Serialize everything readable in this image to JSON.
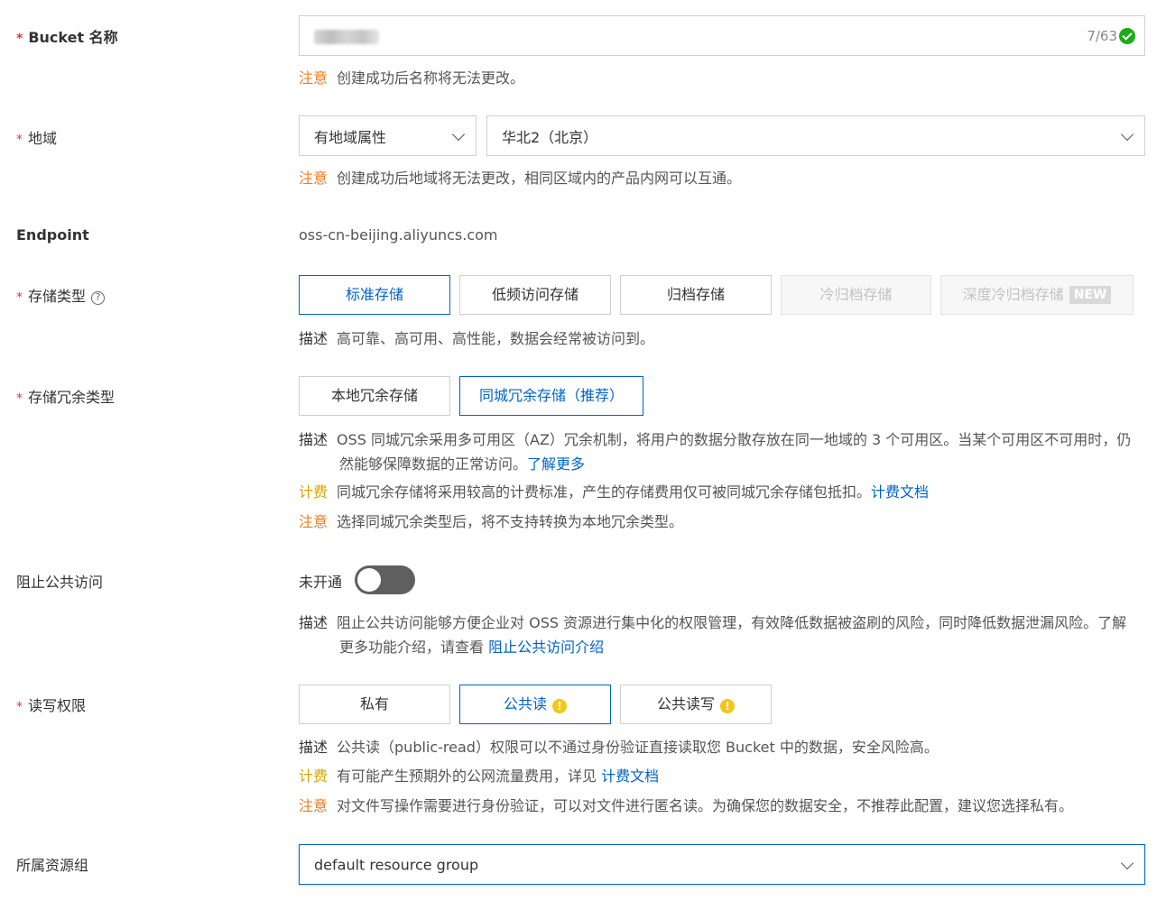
{
  "bucket_name": {
    "label": "Bucket 名称",
    "counter": "7/63",
    "note_tag": "注意",
    "note": "创建成功后名称将无法更改。"
  },
  "region": {
    "label": "地域",
    "attr_select": "有地域属性",
    "region_select": "华北2（北京）",
    "note_tag": "注意",
    "note": "创建成功后地域将无法更改，相同区域内的产品内网可以互通。"
  },
  "endpoint": {
    "label": "Endpoint",
    "value": "oss-cn-beijing.aliyuncs.com"
  },
  "storage_class": {
    "label": "存储类型",
    "options": [
      "标准存储",
      "低频访问存储",
      "归档存储",
      "冷归档存储",
      "深度冷归档存储"
    ],
    "new_badge": "NEW",
    "selected": "标准存储",
    "desc_tag": "描述",
    "desc": "高可靠、高可用、高性能，数据会经常被访问到。"
  },
  "redundancy": {
    "label": "存储冗余类型",
    "options": [
      "本地冗余存储",
      "同城冗余存储（推荐）"
    ],
    "selected": "同城冗余存储（推荐）",
    "desc_tag": "描述",
    "desc": "OSS 同城冗余采用多可用区（AZ）冗余机制，将用户的数据分散存放在同一地域的 3 个可用区。当某个可用区不可用时，仍然能够保障数据的正常访问。",
    "desc_link": "了解更多",
    "fee_tag": "计费",
    "fee": "同城冗余存储将采用较高的计费标准，产生的存储费用仅可被同城冗余存储包抵扣。",
    "fee_link": "计费文档",
    "note_tag": "注意",
    "note": "选择同城冗余类型后，将不支持转换为本地冗余类型。"
  },
  "block_public": {
    "label": "阻止公共访问",
    "toggle_label": "未开通",
    "enabled": false,
    "desc_tag": "描述",
    "desc": "阻止公共访问能够方便企业对 OSS 资源进行集中化的权限管理，有效降低数据被盗刷的风险，同时降低数据泄漏风险。了解更多功能介绍，请查看 ",
    "desc_link": "阻止公共访问介绍"
  },
  "acl": {
    "label": "读写权限",
    "options": [
      "私有",
      "公共读",
      "公共读写"
    ],
    "selected": "公共读",
    "desc_tag": "描述",
    "desc": "公共读（public-read）权限可以不通过身份验证直接读取您 Bucket 中的数据，安全风险高。",
    "fee_tag": "计费",
    "fee": "有可能产生预期外的公网流量费用，详见 ",
    "fee_link": "计费文档",
    "note_tag": "注意",
    "note": "对文件写操作需要进行身份验证，可以对文件进行匿名读。为确保您的数据安全，不推荐此配置，建议您选择私有。"
  },
  "resource_group": {
    "label": "所属资源组",
    "value": "default resource group"
  },
  "colors": {
    "accent": "#0064c8",
    "warn": "#f07c21",
    "fee": "#d9a400",
    "required": "#e53935",
    "success": "#1aad19"
  }
}
